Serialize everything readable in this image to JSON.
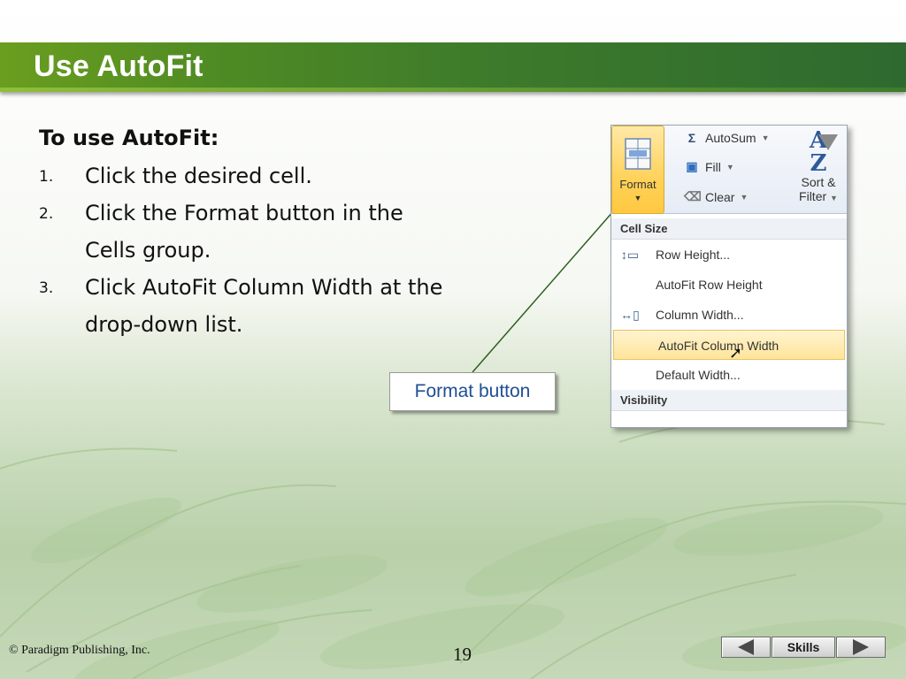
{
  "slide": {
    "title": "Use AutoFit",
    "intro": "To use AutoFit:",
    "steps": [
      {
        "num": "1.",
        "text": "Click the desired cell."
      },
      {
        "num": "2.",
        "text": "Click the Format button in the Cells group."
      },
      {
        "num": "3.",
        "text": "Click AutoFit Column Width at the drop-down list."
      }
    ],
    "callout": "Format button"
  },
  "excel": {
    "format_label": "Format",
    "autosum_label": "AutoSum",
    "fill_label": "Fill",
    "clear_label": "Clear",
    "sort_filter_line1": "Sort &",
    "sort_filter_line2": "Filter",
    "menu": {
      "cell_size_header": "Cell Size",
      "items": [
        "Row Height...",
        "AutoFit Row Height",
        "Column Width...",
        "AutoFit Column Width",
        "Default Width..."
      ],
      "visibility_header": "Visibility"
    }
  },
  "footer": {
    "copyright": "© Paradigm Publishing, Inc.",
    "page_number": "19",
    "skills_label": "Skills"
  },
  "colors": {
    "title_bar_green": "#3d7a2b",
    "callout_text": "#1f4f93",
    "format_highlight": "#ffd25a"
  },
  "icons": {
    "prev": "triangle-left-icon",
    "next": "triangle-right-icon",
    "autosum": "sigma-icon",
    "fill": "fill-down-icon",
    "clear": "eraser-icon",
    "sort": "sort-az-icon"
  }
}
